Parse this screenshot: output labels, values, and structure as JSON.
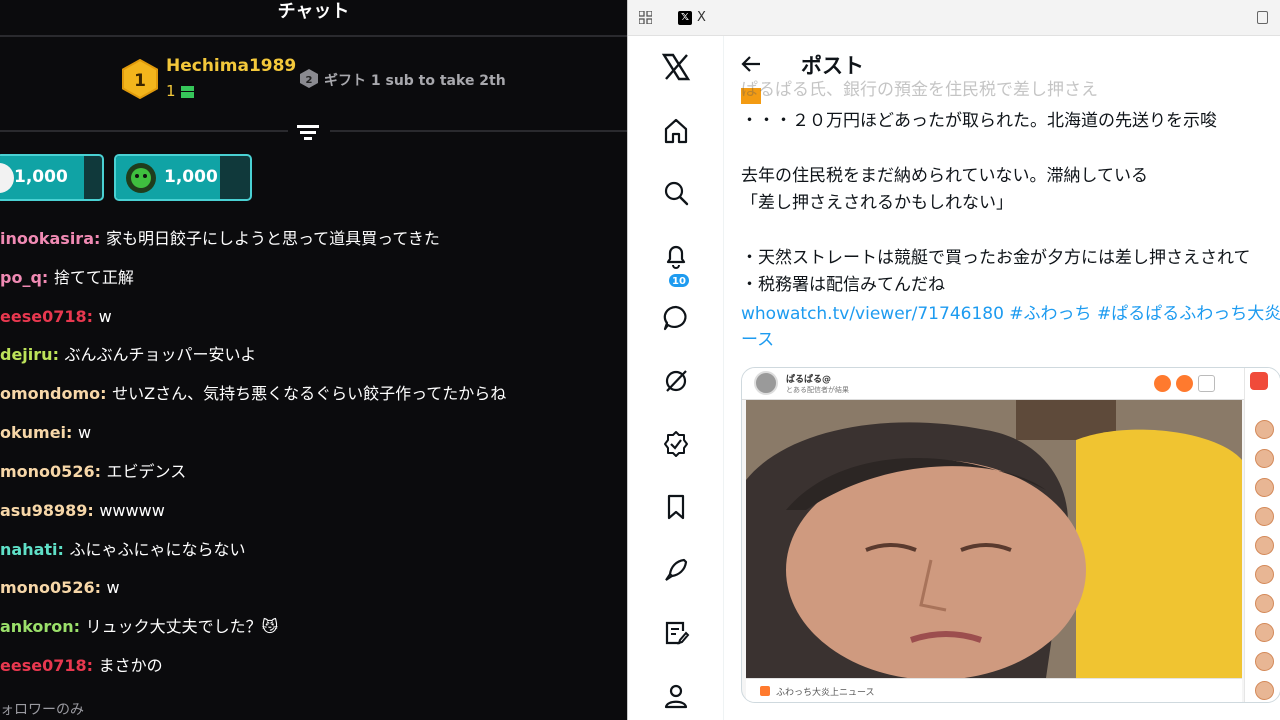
{
  "chat": {
    "title": "チャット",
    "leaderboard": {
      "first": {
        "rank": "1",
        "name": "Hechima1989",
        "count": "1"
      },
      "second": {
        "rank": "2",
        "text": "ギフト 1 sub to take 2th"
      }
    },
    "pills": [
      {
        "value": "1,000"
      },
      {
        "value": "1,000"
      }
    ],
    "messages": [
      {
        "user": "inookasira",
        "color": "#f08ab3",
        "text": "家も明日餃子にしようと思って道具買ってきた"
      },
      {
        "user": "po_q",
        "color": "#f08ab3",
        "text": "捨てて正解"
      },
      {
        "user": "eese0718",
        "color": "#e8384f",
        "text": "w"
      },
      {
        "user": "dejiru",
        "color": "#bde35a",
        "text": "ぶんぶんチョッパー安いよ"
      },
      {
        "user": "omondomo",
        "color": "#f7d7a8",
        "text": "せいZさん、気持ち悪くなるぐらい餃子作ってたからね"
      },
      {
        "user": "okumei",
        "color": "#f7d7a8",
        "text": "w"
      },
      {
        "user": "mono0526",
        "color": "#f7d7a8",
        "text": "エビデンス"
      },
      {
        "user": "asu98989",
        "color": "#f7d7a8",
        "text": "wwwww"
      },
      {
        "user": "nahati",
        "color": "#5fe0c7",
        "text": "ふにゃふにゃにならない"
      },
      {
        "user": "mono0526",
        "color": "#f7d7a8",
        "text": "w"
      },
      {
        "user": "ankoron",
        "color": "#9be06a",
        "text": "リュック大丈夫でした？😼"
      },
      {
        "user": "eese0718",
        "color": "#e8384f",
        "text": "まさかの"
      }
    ],
    "footer": "ォロワーのみ"
  },
  "browser": {
    "tab_title": "X",
    "notif_count": "10",
    "post_header_title": "ポスト",
    "post_lines": [
      "ぱるぱる氏、銀行の預金を住民税で差し押さえ",
      "・・・２０万円ほどあったが取られた。北海道の先送りを示唆",
      "",
      "去年の住民税をまだ納められていない。滞納している",
      "「差し押さえされるかもしれない」",
      "",
      "・天然ストレートは競艇で買ったお金が夕方には差し押さえされて",
      "・税務署は配信みてんだね"
    ],
    "link_line1": "whowatch.tv/viewer/71746180 #ふわっち #ぱるぱるふわっち大炎",
    "link_line2": "ース",
    "embed": {
      "stream_name": "ぱるぱる@",
      "stream_sub": "とある配信者が結果",
      "bottom_text": "ふわっち大炎上ニュース"
    }
  }
}
